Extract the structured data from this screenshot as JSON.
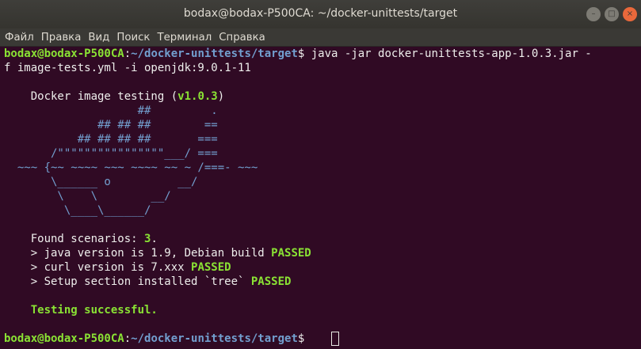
{
  "window": {
    "title": "bodax@bodax-P500CA: ~/docker-unittests/target",
    "controls": {
      "minimize": "–",
      "maximize": "□",
      "close": "×"
    }
  },
  "menu": {
    "items": [
      "Файл",
      "Правка",
      "Вид",
      "Поиск",
      "Терминал",
      "Справка"
    ]
  },
  "terminal": {
    "prompt1": {
      "user": "bodax@bodax-P500CA",
      "colon": ":",
      "path": "~/docker-unittests/target",
      "dollar": "$ ",
      "command": "java -jar docker-unittests-app-1.0.3.jar -"
    },
    "line2": "f image-tests.yml -i openjdk:9.0.1-11",
    "banner": {
      "title_prefix": "    Docker image testing (",
      "version": "v1.0.3",
      "title_suffix": ")",
      "art": [
        "                    ##         .",
        "              ## ## ##        ==",
        "           ## ## ## ##       ===",
        "       /\"\"\"\"\"\"\"\"\"\"\"\"\"\"\"\"___/ ===",
        "  ~~~ {~~ ~~~~ ~~~ ~~~~ ~~ ~ /===- ~~~",
        "       \\______ o          __/",
        "        \\    \\        __/",
        "         \\____\\______/"
      ]
    },
    "found_prefix": "    Found scenarios: ",
    "found_count": "3",
    "found_suffix": ".",
    "results": [
      {
        "text": "    > java version is 1.9, Debian build ",
        "status": "PASSED"
      },
      {
        "text": "    > curl version is 7.xxx ",
        "status": "PASSED"
      },
      {
        "text": "    > Setup section installed `tree` ",
        "status": "PASSED"
      }
    ],
    "success_message": "    Testing successful.",
    "prompt2": {
      "user": "bodax@bodax-P500CA",
      "colon": ":",
      "path": "~/docker-unittests/target",
      "dollar": "$ "
    }
  },
  "colors": {
    "background": "#300a24",
    "prompt_user": "#8ae234",
    "prompt_path": "#729fcf",
    "text": "#eeeeec",
    "success": "#8ae234",
    "close_button": "#e9683b"
  }
}
